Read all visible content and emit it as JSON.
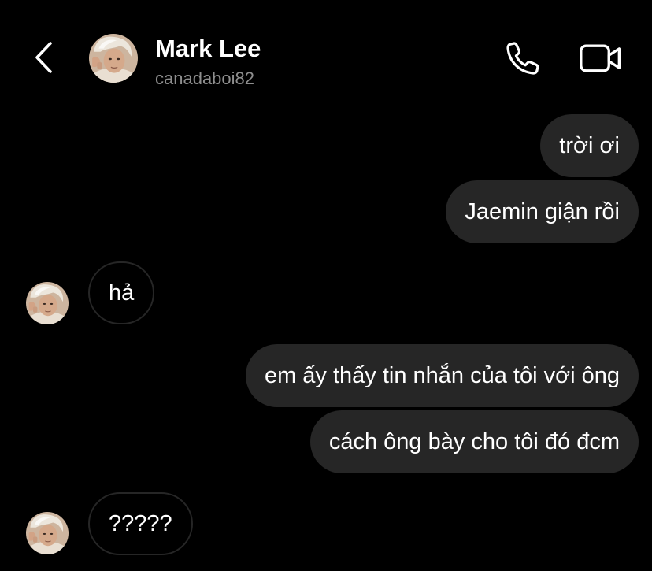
{
  "header": {
    "contact_name": "Mark Lee",
    "contact_username": "canadaboi82"
  },
  "messages": [
    {
      "direction": "sent",
      "text": "trời ơi"
    },
    {
      "direction": "sent",
      "text": "Jaemin giận rồi"
    },
    {
      "direction": "received",
      "text": "hả"
    },
    {
      "direction": "sent",
      "text": "em ấy thấy tin nhắn của tôi với ông"
    },
    {
      "direction": "sent",
      "text": "cách ông bày cho tôi đó đcm"
    },
    {
      "direction": "received",
      "text": "?????"
    }
  ],
  "colors": {
    "background": "#000000",
    "sent_bubble": "#262626",
    "received_border": "#262626",
    "secondary_text": "#8e8e8e",
    "divider": "#262626"
  },
  "icons": {
    "back": "chevron-left-icon",
    "call": "phone-icon",
    "video": "video-camera-icon"
  }
}
